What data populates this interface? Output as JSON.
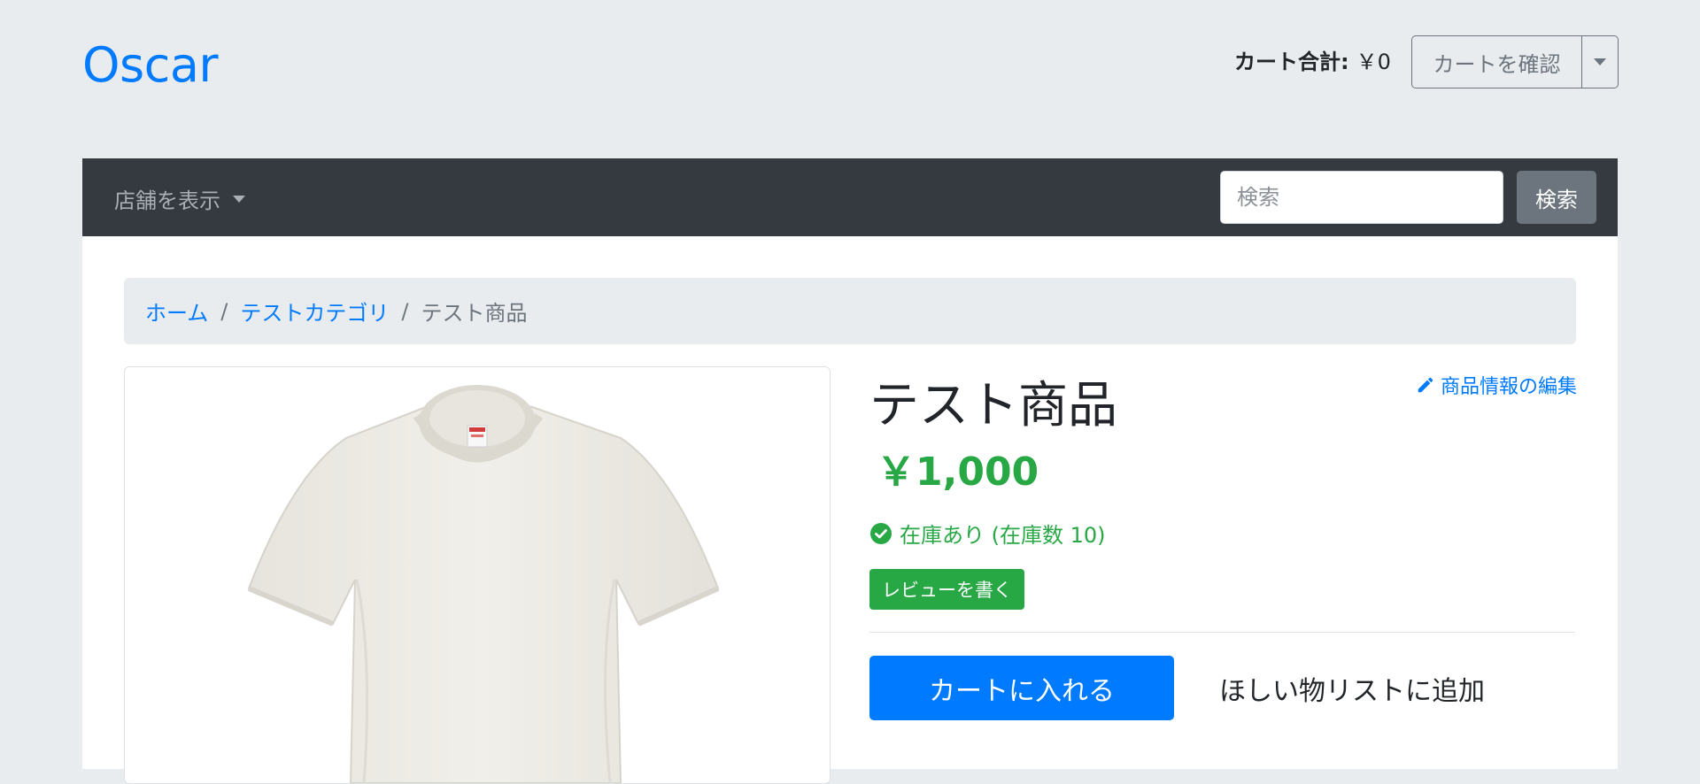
{
  "header": {
    "brand": "Oscar",
    "cart_total_label": "カート合計:",
    "cart_total_value": "￥0",
    "view_cart_label": "カートを確認",
    "dropdown_icon": "caret-down-icon"
  },
  "navbar": {
    "browse_label": "店舗を表示",
    "search_placeholder": "検索",
    "search_button": "検索"
  },
  "breadcrumb": {
    "items": [
      "ホーム",
      "テストカテゴリ"
    ],
    "separator": "/",
    "active": "テスト商品"
  },
  "product": {
    "image_alt": "white t-shirt",
    "title": "テスト商品",
    "edit_label": "商品情報の編集",
    "edit_icon": "pencil-icon",
    "price": "￥1,000",
    "stock_text": "在庫あり (在庫数 10)",
    "stock_icon": "check-circle-icon",
    "review_button": "レビューを書く",
    "add_to_cart": "カートに入れる",
    "wishlist": "ほしい物リストに追加"
  },
  "colors": {
    "primary": "#007bff",
    "success": "#28a745",
    "navbar_bg": "#343a40",
    "secondary": "#6c757d"
  }
}
